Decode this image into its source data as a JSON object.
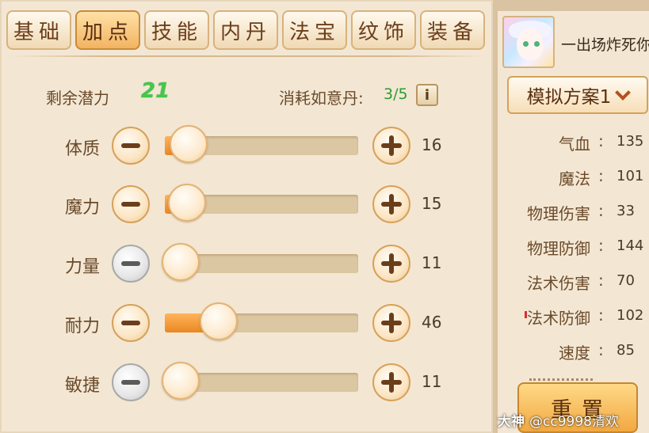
{
  "tabs": [
    {
      "label": "基础",
      "active": false
    },
    {
      "label": "加点",
      "active": true
    },
    {
      "label": "技能",
      "active": false
    },
    {
      "label": "内丹",
      "active": false
    },
    {
      "label": "法宝",
      "active": false
    },
    {
      "label": "纹饰",
      "active": false
    },
    {
      "label": "装备",
      "active": false
    }
  ],
  "potential": {
    "remaining_label": "剩余潜力",
    "remaining_value": "21",
    "consume_label": "消耗如意丹:",
    "consume_value": "3/5",
    "info_icon": "i"
  },
  "attributes": [
    {
      "name": "体质",
      "value": "16",
      "level": 0.12,
      "minus_enabled": true
    },
    {
      "name": "魔力",
      "value": "15",
      "level": 0.11,
      "minus_enabled": true
    },
    {
      "name": "力量",
      "value": "11",
      "level": 0.0,
      "minus_enabled": false
    },
    {
      "name": "耐力",
      "value": "46",
      "level": 0.28,
      "minus_enabled": true
    },
    {
      "name": "敏捷",
      "value": "11",
      "level": 0.0,
      "minus_enabled": false
    }
  ],
  "side": {
    "player_name": "一出场炸死你",
    "plan_label": "模拟方案1",
    "stats": [
      {
        "name": "气血",
        "value": "135"
      },
      {
        "name": "魔法",
        "value": "101"
      },
      {
        "name": "物理伤害",
        "value": "33"
      },
      {
        "name": "物理防御",
        "value": "144"
      },
      {
        "name": "法术伤害",
        "value": "70"
      },
      {
        "name": "法术防御",
        "value": "102"
      },
      {
        "name": "速度",
        "value": "85"
      }
    ],
    "reset_label": "重置"
  },
  "watermark": {
    "brand": "大神",
    "text": "@cc9998清欢"
  },
  "colors": {
    "accent_orange": "#e98723",
    "green_value": "#42c84a",
    "text_brown": "#6b4a2a"
  }
}
